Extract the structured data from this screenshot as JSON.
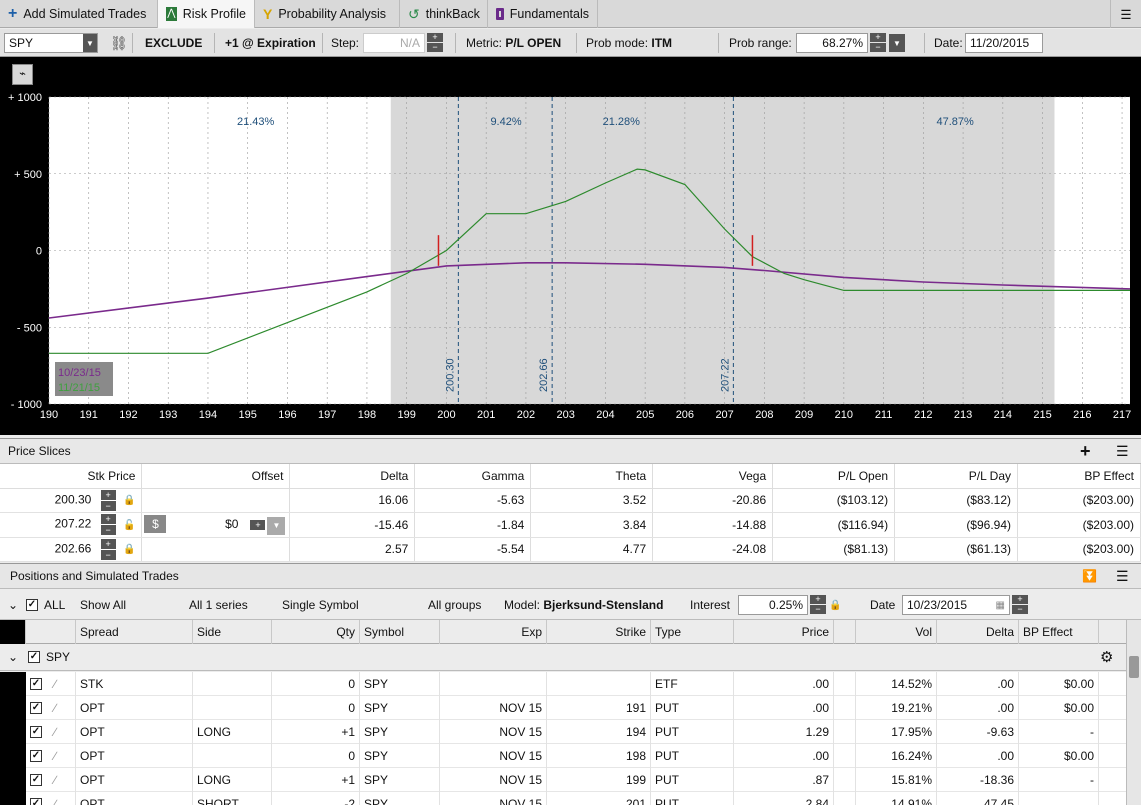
{
  "tabs": [
    {
      "label": "Add Simulated Trades",
      "icon": "plus-icon"
    },
    {
      "label": "Risk Profile",
      "icon": "risk-profile-icon"
    },
    {
      "label": "Probability Analysis",
      "icon": "probability-icon"
    },
    {
      "label": "thinkBack",
      "icon": "thinkback-icon"
    },
    {
      "label": "Fundamentals",
      "icon": "fundamentals-icon"
    }
  ],
  "toolbar": {
    "symbol": "SPY",
    "exclude": "EXCLUDE",
    "expiration": "+1 @ Expiration",
    "step_label": "Step:",
    "step_value": "N/A",
    "metric_label": "Metric:",
    "metric_value": "P/L OPEN",
    "probmode_label": "Prob mode:",
    "probmode_value": "ITM",
    "probrange_label": "Prob range:",
    "probrange_value": "68.27%",
    "date_label": "Date:",
    "date_value": "11/20/2015"
  },
  "chart_data": {
    "type": "line",
    "x_ticks": [
      190,
      191,
      192,
      193,
      194,
      195,
      196,
      197,
      198,
      199,
      200,
      201,
      202,
      203,
      204,
      205,
      206,
      207,
      208,
      209,
      210,
      211,
      212,
      213,
      214,
      215,
      216,
      217
    ],
    "y_ticks": [
      "+ 1000",
      "+ 500",
      "0",
      "- 500",
      "- 1000"
    ],
    "ylim": [
      -1000,
      1000
    ],
    "xlim": [
      190,
      217.2
    ],
    "prob_zones": [
      {
        "label": "21.43%",
        "x": 195.2
      },
      {
        "label": "9.42%",
        "x": 201.5
      },
      {
        "label": "21.28%",
        "x": 204.4
      },
      {
        "label": "47.87%",
        "x": 212.8
      }
    ],
    "shaded_range": [
      198.6,
      215.3
    ],
    "slice_lines": [
      {
        "label": "200.30",
        "x": 200.3
      },
      {
        "label": "202.66",
        "x": 202.66
      },
      {
        "label": "207.22",
        "x": 207.22
      }
    ],
    "breakevens": [
      199.8,
      207.7
    ],
    "legend": [
      "10/23/15",
      "11/21/15"
    ],
    "series": [
      {
        "name": "10/23/15",
        "color": "#7a2a8c",
        "points": [
          [
            190,
            -440
          ],
          [
            194,
            -310
          ],
          [
            198,
            -170
          ],
          [
            200,
            -100
          ],
          [
            202,
            -80
          ],
          [
            203,
            -80
          ],
          [
            205,
            -90
          ],
          [
            207,
            -110
          ],
          [
            208,
            -130
          ],
          [
            210,
            -175
          ],
          [
            212,
            -205
          ],
          [
            214,
            -225
          ],
          [
            217.2,
            -250
          ]
        ]
      },
      {
        "name": "11/21/15",
        "color": "#2d8a2d",
        "points": [
          [
            190,
            -670
          ],
          [
            194,
            -670
          ],
          [
            196,
            -470
          ],
          [
            198,
            -270
          ],
          [
            199,
            -150
          ],
          [
            200,
            0
          ],
          [
            201,
            240
          ],
          [
            202,
            240
          ],
          [
            203,
            320
          ],
          [
            204,
            440
          ],
          [
            204.8,
            530
          ],
          [
            205,
            525
          ],
          [
            206,
            430
          ],
          [
            207,
            140
          ],
          [
            207.7,
            -40
          ],
          [
            208.5,
            -150
          ],
          [
            209,
            -190
          ],
          [
            210,
            -260
          ],
          [
            217.2,
            -260
          ]
        ]
      }
    ]
  },
  "price_slices": {
    "title": "Price Slices",
    "headers": [
      "Stk Price",
      "Offset",
      "Delta",
      "Gamma",
      "Theta",
      "Vega",
      "P/L Open",
      "P/L Day",
      "BP Effect"
    ],
    "rows": [
      {
        "price": "200.30",
        "offset": "",
        "delta": "16.06",
        "gamma": "-5.63",
        "theta": "3.52",
        "vega": "-20.86",
        "pl_open": "($103.12)",
        "pl_day": "($83.12)",
        "bp": "($203.00)"
      },
      {
        "price": "207.22",
        "offset": "$0",
        "delta": "-15.46",
        "gamma": "-1.84",
        "theta": "3.84",
        "vega": "-14.88",
        "pl_open": "($116.94)",
        "pl_day": "($96.94)",
        "bp": "($203.00)"
      },
      {
        "price": "202.66",
        "offset": "",
        "delta": "2.57",
        "gamma": "-5.54",
        "theta": "4.77",
        "vega": "-24.08",
        "pl_open": "($81.13)",
        "pl_day": "($61.13)",
        "bp": "($203.00)"
      }
    ]
  },
  "positions": {
    "title": "Positions and Simulated Trades",
    "filters": {
      "all": "ALL",
      "show": "Show All",
      "series": "All 1 series",
      "symbol": "Single Symbol",
      "groups": "All groups",
      "model_label": "Model:",
      "model_value": "Bjerksund-Stensland",
      "interest_label": "Interest",
      "interest_value": "0.25%",
      "date_label": "Date",
      "date_value": "10/23/2015"
    },
    "columns": [
      "Spread",
      "Side",
      "Qty",
      "Symbol",
      "Exp",
      "Strike",
      "Type",
      "Price",
      "Vol",
      "Delta",
      "BP Effect"
    ],
    "group": "SPY",
    "rows": [
      {
        "spread": "STK",
        "side": "",
        "qty": "0",
        "symbol": "SPY",
        "exp": "",
        "strike": "",
        "type": "ETF",
        "price": ".00",
        "vol": "14.52%",
        "delta": ".00",
        "bp": "$0.00"
      },
      {
        "spread": "OPT",
        "side": "",
        "qty": "0",
        "symbol": "SPY",
        "exp": "NOV 15",
        "strike": "191",
        "type": "PUT",
        "price": ".00",
        "vol": "19.21%",
        "delta": ".00",
        "bp": "$0.00"
      },
      {
        "spread": "OPT",
        "side": "LONG",
        "qty": "+1",
        "symbol": "SPY",
        "exp": "NOV 15",
        "strike": "194",
        "type": "PUT",
        "price": "1.29",
        "vol": "17.95%",
        "delta": "-9.63",
        "bp": "-"
      },
      {
        "spread": "OPT",
        "side": "",
        "qty": "0",
        "symbol": "SPY",
        "exp": "NOV 15",
        "strike": "198",
        "type": "PUT",
        "price": ".00",
        "vol": "16.24%",
        "delta": ".00",
        "bp": "$0.00"
      },
      {
        "spread": "OPT",
        "side": "LONG",
        "qty": "+1",
        "symbol": "SPY",
        "exp": "NOV 15",
        "strike": "199",
        "type": "PUT",
        "price": ".87",
        "vol": "15.81%",
        "delta": "-18.36",
        "bp": "-"
      },
      {
        "spread": "OPT",
        "side": "SHORT",
        "qty": "-2",
        "symbol": "SPY",
        "exp": "NOV 15",
        "strike": "201",
        "type": "PUT",
        "price": "2.84",
        "vol": "14.91%",
        "delta": "47.45",
        "bp": ""
      }
    ]
  },
  "colors": {
    "purple_series": "#7a2a8c",
    "green_series": "#2d8a2d",
    "shade": "#d8d8d8",
    "slice_line": "#1f4f7a",
    "breakeven": "#d22020"
  }
}
